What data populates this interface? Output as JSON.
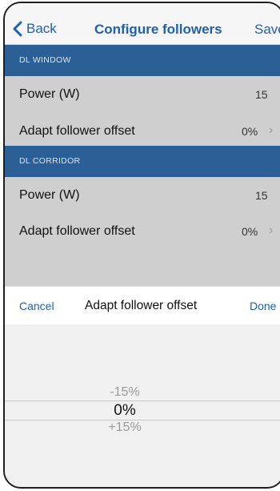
{
  "navbar": {
    "back_label": "Back",
    "title": "Configure followers",
    "save_label": "Save"
  },
  "sections": [
    {
      "header": "DL WINDOW",
      "rows": [
        {
          "label": "Power (W)",
          "value": "15"
        },
        {
          "label": "Adapt follower offset",
          "value": "0%"
        }
      ]
    },
    {
      "header": "DL CORRIDOR",
      "rows": [
        {
          "label": "Power (W)",
          "value": "15"
        },
        {
          "label": "Adapt follower offset",
          "value": "0%"
        }
      ]
    }
  ],
  "picker_toolbar": {
    "cancel_label": "Cancel",
    "title": "Adapt follower offset",
    "done_label": "Done"
  },
  "picker": {
    "options": [
      "-15%",
      "0%",
      "+15%"
    ],
    "selected": "0%"
  },
  "colors": {
    "accent": "#1f5fb0",
    "section_header_bg": "#2b5f95",
    "row_bg": "#cfcfcf"
  }
}
